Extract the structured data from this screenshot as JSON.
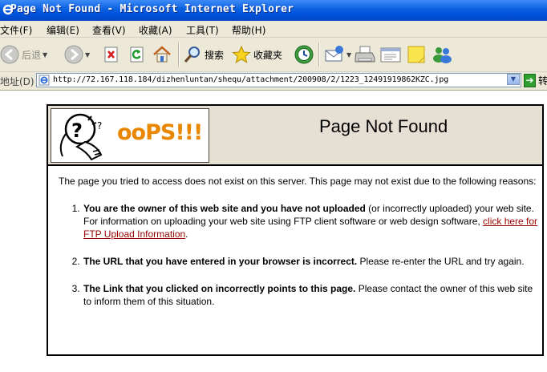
{
  "window": {
    "title": "Page Not Found - Microsoft Internet Explorer"
  },
  "menu": {
    "items": [
      "文件(F)",
      "编辑(E)",
      "查看(V)",
      "收藏(A)",
      "工具(T)",
      "帮助(H)"
    ]
  },
  "toolbar": {
    "back_label": "后退",
    "search_label": "搜索",
    "favorites_label": "收藏夹"
  },
  "address": {
    "label": "地址(D)",
    "url": "http://72.167.118.184/dizhenluntan/shequ/attachment/200908/2/1223_12491919862KZC.jpg",
    "go_label": "转"
  },
  "page": {
    "logo_text": "ooPS!!!",
    "title": "Page Not Found",
    "intro": "The page you tried to access does not exist on this server. This page may not exist due to the following reasons:",
    "reasons": [
      {
        "bold": "You are the owner of this web site and you have not uploaded",
        "text": " (or incorrectly uploaded) your web site. For information on uploading your web site using FTP client software or web design software, ",
        "link": "click here for FTP Upload Information",
        "after": "."
      },
      {
        "bold": "The URL that you have entered in your browser is incorrect.",
        "text": " Please re-enter the URL and try again."
      },
      {
        "bold": "The Link that you clicked on incorrectly points to this page.",
        "text": " Please contact the owner of this web site to inform them of this situation."
      }
    ]
  },
  "icons": {
    "title": "ie-logo-icon",
    "back": "back-arrow-icon",
    "forward": "forward-arrow-icon",
    "stop": "stop-icon",
    "refresh": "refresh-icon",
    "home": "home-icon",
    "search": "magnifier-icon",
    "favorites": "star-icon",
    "history": "history-icon",
    "mail": "mail-icon",
    "print": "printer-icon",
    "edit": "edit-icon",
    "discuss": "note-icon",
    "messenger": "messenger-icon"
  },
  "colors": {
    "titlebar": "#0a5fe0",
    "chrome": "#ece9d8",
    "header_bg": "#e6e0d4",
    "logo_text": "#e98800",
    "link": "#990000"
  }
}
